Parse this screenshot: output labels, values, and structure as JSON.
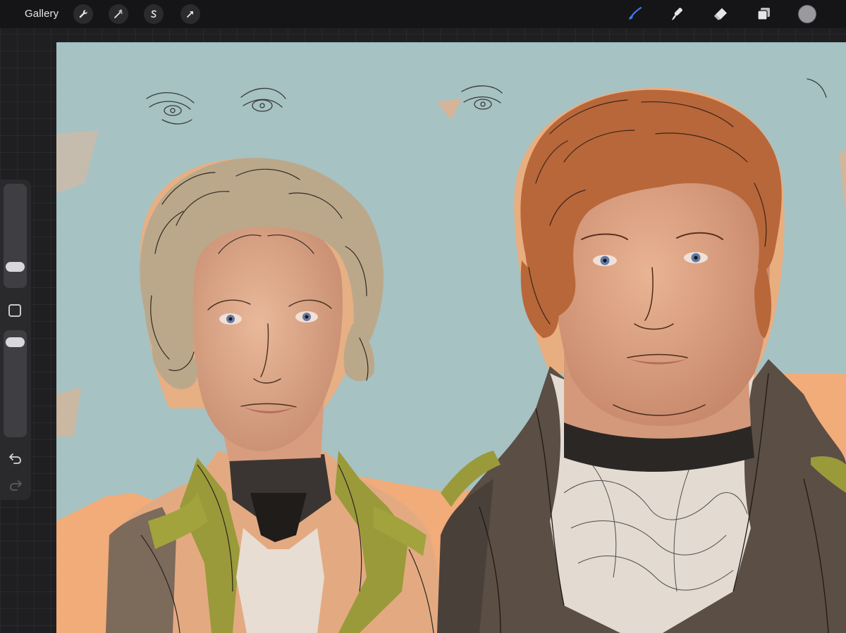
{
  "toolbar": {
    "gallery_label": "Gallery",
    "left_tools": [
      {
        "name": "actions",
        "icon": "wrench-icon"
      },
      {
        "name": "adjustments",
        "icon": "magic-wand-icon"
      },
      {
        "name": "selection",
        "icon": "selection-s-icon"
      },
      {
        "name": "transform",
        "icon": "arrow-cursor-icon"
      }
    ],
    "right_tools": [
      {
        "name": "brush",
        "icon": "brush-icon",
        "active": true
      },
      {
        "name": "smudge",
        "icon": "smudge-icon",
        "active": false
      },
      {
        "name": "eraser",
        "icon": "eraser-icon",
        "active": false
      },
      {
        "name": "layers",
        "icon": "layers-icon",
        "active": false
      }
    ],
    "active_color": "#9a9a9e",
    "accent_color": "#3d7bf5"
  },
  "sidebar": {
    "brush_size_level": 0.14,
    "opacity_level": 0.97,
    "modify_icon": "square-icon",
    "undo_icon": "undo-arrow-icon",
    "redo_icon": "redo-arrow-icon"
  },
  "canvas": {
    "background_color": "#a6c2c3",
    "artwork": "portrait-sketch-two-men"
  }
}
